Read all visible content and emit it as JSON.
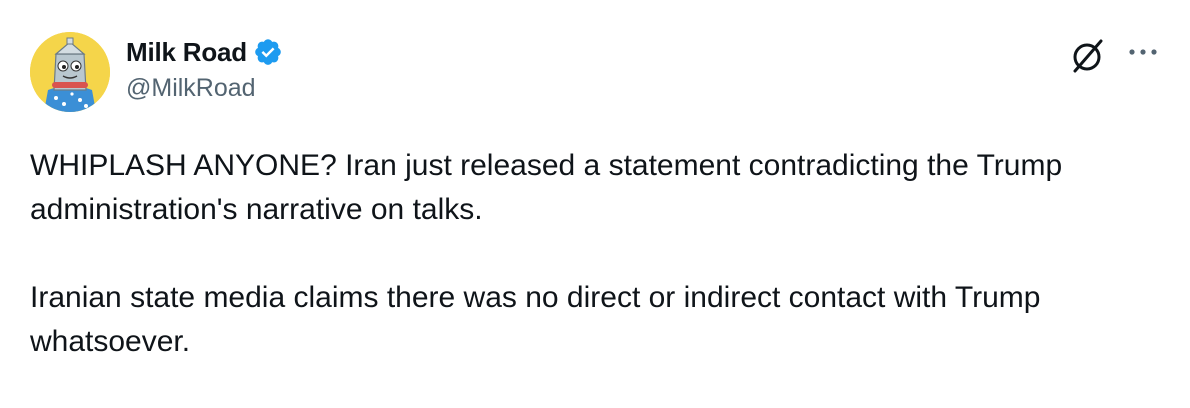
{
  "author": {
    "display_name": "Milk Road",
    "handle": "@MilkRoad",
    "verified": true,
    "avatar_icon": "milk-carton-mascot-avatar"
  },
  "actions": {
    "grok_icon": "grok-slash-icon",
    "more_icon": "more-horizontal-icon"
  },
  "tweet": {
    "paragraphs": [
      "WHIPLASH ANYONE? Iran just released a statement contradicting the Trump administration's narrative on talks.",
      "Iranian state media claims there was no direct or indirect contact with Trump whatsoever."
    ]
  },
  "colors": {
    "text": "#0f1419",
    "secondary": "#536471",
    "verified_blue": "#1d9bf0",
    "avatar_bg": "#f5d54a"
  }
}
